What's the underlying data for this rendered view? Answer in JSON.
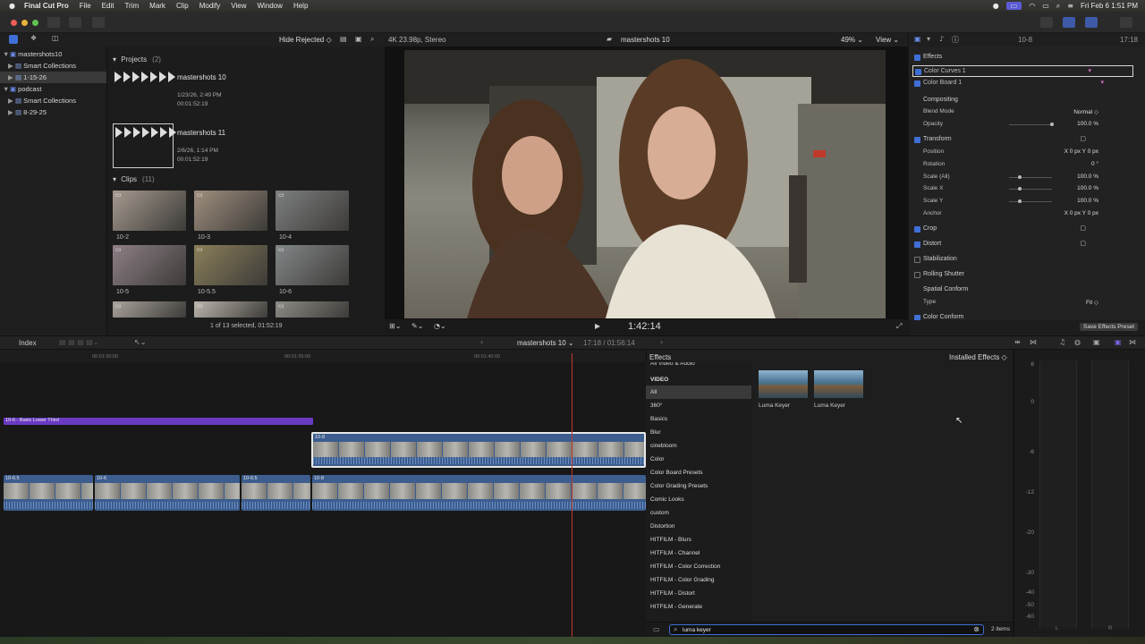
{
  "menubar": {
    "app": "Final Cut Pro",
    "items": [
      "File",
      "Edit",
      "Trim",
      "Mark",
      "Clip",
      "Modify",
      "View",
      "Window",
      "Help"
    ],
    "datetime": "Fri Feb 6  1:51 PM"
  },
  "browser_bar": {
    "filter": "Hide Rejected"
  },
  "libraries": [
    {
      "label": "mastershots10",
      "indent": 0,
      "tri": "▼"
    },
    {
      "label": "Smart Collections",
      "indent": 1,
      "tri": "▶"
    },
    {
      "label": "1-15-26",
      "indent": 1,
      "tri": "▶",
      "selected": true
    },
    {
      "label": "podcast",
      "indent": 0,
      "tri": "▼"
    },
    {
      "label": "Smart Collections",
      "indent": 1,
      "tri": "▶"
    },
    {
      "label": "8-29-25",
      "indent": 1,
      "tri": "▶"
    }
  ],
  "projects": {
    "header": "Projects",
    "count": "(2)",
    "items": [
      {
        "name": "mastershots 10",
        "date": "1/23/26, 2:49 PM",
        "duration": "00:01:52:19"
      },
      {
        "name": "mastershots 11",
        "date": "2/6/26, 1:14 PM",
        "duration": "00:01:52:19"
      }
    ]
  },
  "clips": {
    "header": "Clips",
    "count": "(11)",
    "items": [
      "10-2",
      "10-3",
      "10-4",
      "10-5",
      "10-5.5",
      "10-6",
      "",
      "",
      ""
    ]
  },
  "browser_status": "1 of 13 selected, 01:52:19",
  "viewer": {
    "format": "4K 23.98p, Stereo",
    "project": "mastershots 10",
    "zoom": "49%",
    "view": "View",
    "timecode": "1:42:14"
  },
  "inspector": {
    "clip": "10-8",
    "duration": "17:18",
    "save_preset": "Save Effects Preset",
    "rows": [
      {
        "label": "Effects",
        "check": "on",
        "kind": "head"
      },
      {
        "label": "Color Curves 1",
        "check": "on",
        "kind": "sub",
        "selected": true
      },
      {
        "label": "Color Board 1",
        "check": "on",
        "kind": "sub"
      },
      {
        "label": "Compositing",
        "check": "none",
        "kind": "head"
      },
      {
        "label": "Blend Mode",
        "check": "none",
        "kind": "sub",
        "value": "Normal ◇"
      },
      {
        "label": "Opacity",
        "check": "none",
        "kind": "sub",
        "value": "100.0  %"
      },
      {
        "label": "Transform",
        "check": "on",
        "kind": "head"
      },
      {
        "label": "Position",
        "check": "none",
        "kind": "sub",
        "value": "X      0  px    Y      0  px"
      },
      {
        "label": "Rotation",
        "check": "none",
        "kind": "sub",
        "value": "0  °"
      },
      {
        "label": "Scale (All)",
        "check": "none",
        "kind": "sub",
        "value": "100.0  %"
      },
      {
        "label": "Scale X",
        "check": "none",
        "kind": "sub",
        "value": "100.0  %"
      },
      {
        "label": "Scale Y",
        "check": "none",
        "kind": "sub",
        "value": "100.0  %"
      },
      {
        "label": "Anchor",
        "check": "none",
        "kind": "sub",
        "value": "X      0  px    Y      0  px"
      },
      {
        "label": "Crop",
        "check": "on",
        "kind": "head"
      },
      {
        "label": "Distort",
        "check": "on",
        "kind": "head"
      },
      {
        "label": "Stabilization",
        "check": "off",
        "kind": "head"
      },
      {
        "label": "Rolling Shutter",
        "check": "off",
        "kind": "head"
      },
      {
        "label": "Spatial Conform",
        "check": "none",
        "kind": "head"
      },
      {
        "label": "Type",
        "check": "none",
        "kind": "sub",
        "value": "Fit ◇"
      },
      {
        "label": "Color Conform",
        "check": "on",
        "kind": "head"
      }
    ]
  },
  "timeline_bar": {
    "index": "Index",
    "project": "mastershots 10",
    "position": "17:18 / 01:56:14"
  },
  "ruler": [
    "00:01:30:00",
    "00:01:35:00",
    "00:01:40:00"
  ],
  "title_clip": "10-6 - Basic Lower Third",
  "clip_names": {
    "main": "10-8",
    "a": "10-6.5",
    "b": "10-6",
    "c": "10-6.5",
    "d": "10-8"
  },
  "effects": {
    "header": "Effects",
    "source": "Installed Effects",
    "group_video": "VIDEO",
    "top_cut": "All Video & Audio",
    "categories": [
      "All",
      "360°",
      "Basics",
      "Blur",
      "cinebloom",
      "Color",
      "Color Board Presets",
      "Color Grading Presets",
      "Comic Looks",
      "custom",
      "Distortion",
      "HITFILM - Blurs",
      "HITFILM - Channel",
      "HITFILM - Color Correction",
      "HITFILM - Color Grading",
      "HITFILM - Distort",
      "HITFILM - Generate"
    ],
    "results": [
      "Luma Keyer",
      "Luma Keyer"
    ],
    "search": "luma keyer",
    "count": "2 items"
  },
  "meters": {
    "labels": [
      "6",
      "0",
      "-6",
      "-12",
      "-20",
      "-30",
      "-40",
      "-50",
      "-60"
    ],
    "channels": [
      "L",
      "R"
    ]
  }
}
